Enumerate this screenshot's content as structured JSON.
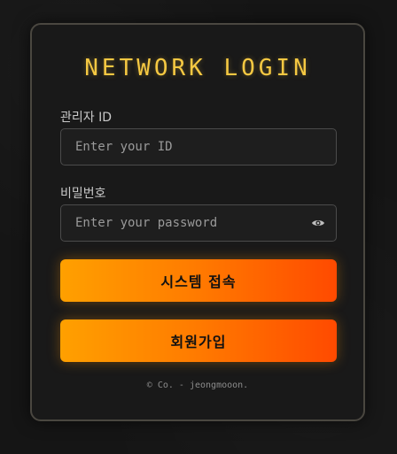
{
  "login": {
    "title": "NETWORK LOGIN",
    "id_label": "관리자 ID",
    "id_placeholder": "Enter your ID",
    "password_label": "비밀번호",
    "password_placeholder": "Enter your password",
    "submit_label": "시스템 접속",
    "signup_label": "회원가입",
    "footer": "© Co. - jeongmooon."
  },
  "icons": {
    "password_toggle": "eye-icon"
  },
  "colors": {
    "title": "#f5c842",
    "button_gradient_start": "#ffa000",
    "button_gradient_end": "#ff4a00",
    "card_border": "#4a4740",
    "background": "#151515"
  }
}
